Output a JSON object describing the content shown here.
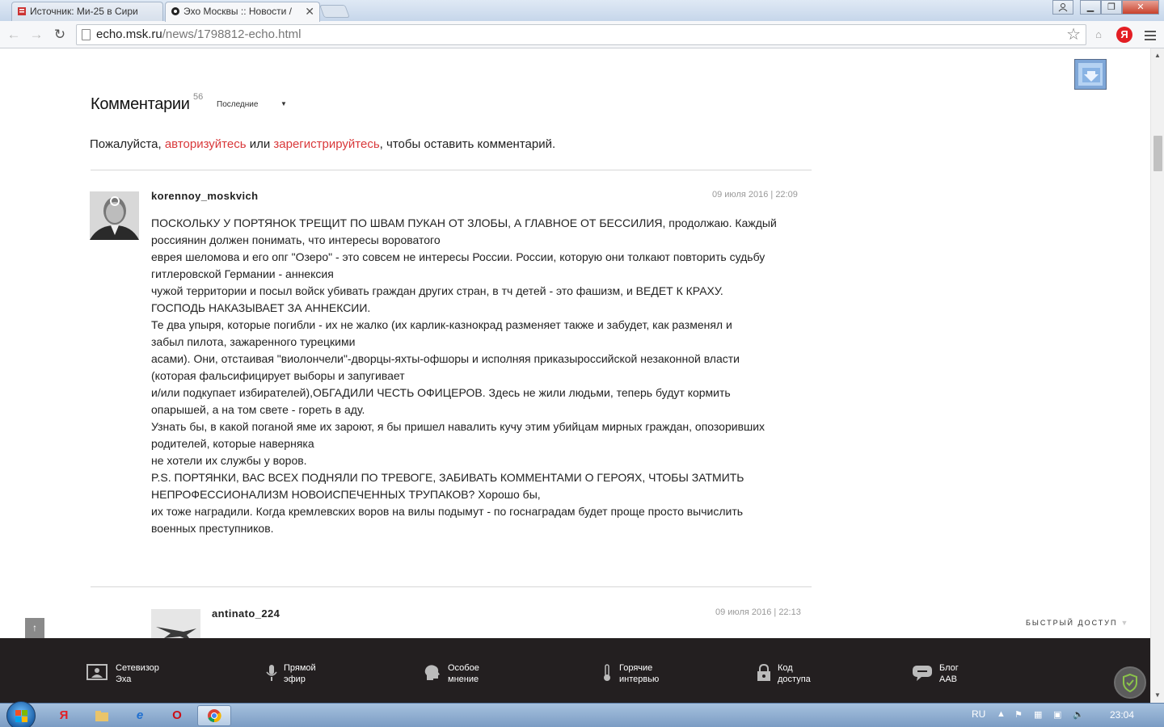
{
  "browser": {
    "tabs": [
      {
        "label": "Источник: Ми-25 в Сири",
        "active": false
      },
      {
        "label": "Эхо Москвы :: Новости /",
        "active": true
      }
    ],
    "url_domain": "echo.msk.ru",
    "url_path": "/news/1798812-echo.html",
    "yandex_ext_label": "Я"
  },
  "comments": {
    "title": "Комментарии",
    "count": "56",
    "sort_label": "Последние",
    "auth": {
      "prefix": "Пожалуйста, ",
      "login_link": "авторизуйтесь",
      "middle": " или ",
      "register_link": "зарегистрируйтесь",
      "suffix": ", чтобы оставить комментарий."
    },
    "items": [
      {
        "username": "korennoy_moskvich",
        "timestamp": "09 июля 2016 | 22:09",
        "lines": [
          "ПОСКОЛЬКУ У ПОРТЯНОК ТРЕЩИТ ПО ШВАМ ПУКАН ОТ ЗЛОБЫ, А ГЛАВНОЕ ОТ БЕССИЛИЯ, продолжаю. Каждый",
          "россиянин должен понимать, что интересы вороватого",
          "еврея шеломова и его опг \"Озеро\" - это совсем не интересы России. России, которую они толкают повторить судьбу",
          "гитлеровской Германии - аннексия",
          "чужой территории и посыл войск убивать граждан других стран, в тч детей - это фашизм, и ВЕДЕТ К КРАХУ.",
          "ГОСПОДЬ НАКАЗЫВАЕТ ЗА АННЕКСИИ.",
          "Те два упыря, которые погибли - их не жалко (их карлик-казнокрад разменяет также и забудет, как разменял и",
          "забыл пилота, зажаренного турецкими",
          "асами). Они, отстаивая \"виолончели\"-дворцы-яхты-офшоры и исполняя приказыроссийской незаконной власти",
          "(которая фальсифицирует выборы и запугивает",
          "и/или подкупает избирателей),ОБГАДИЛИ ЧЕСТЬ ОФИЦЕРОВ. Здесь не жили людьми, теперь будут кормить",
          "опарышей, а на том свете - гореть в аду.",
          "Узнать бы, в какой поганой яме их зароют, я бы пришел навалить кучу этим убийцам мирных граждан, опозоривших",
          "родителей, которые наверняка",
          "не хотели их службы у воров.",
          "P.S. ПОРТЯНКИ, ВАС ВСЕХ ПОДНЯЛИ ПО ТРЕВОГЕ, ЗАБИВАТЬ КОММЕНТАМИ О ГЕРОЯХ, ЧТОБЫ ЗАТМИТЬ",
          "НЕПРОФЕССИОНАЛИЗМ НОВОИСПЕЧЕННЫХ ТРУПАКОВ? Хорошо бы,",
          "их тоже наградили. Когда кремлевских воров на вилы подымут - по госнаградам будет проще просто вычислить",
          "военных преступников."
        ]
      },
      {
        "username": "antinato_224",
        "timestamp": "09 июля 2016 | 22:13"
      }
    ]
  },
  "quick_access": "БЫСТРЫЙ ДОСТУП",
  "bottom_nav": [
    {
      "line1": "Сетевизор",
      "line2": "Эха",
      "icon": "tv-icon"
    },
    {
      "line1": "Прямой",
      "line2": "эфир",
      "icon": "microphone-icon"
    },
    {
      "line1": "Особое",
      "line2": "мнение",
      "icon": "head-icon"
    },
    {
      "line1": "Горячие",
      "line2": "интервью",
      "icon": "thermometer-icon"
    },
    {
      "line1": "Код",
      "line2": "доступа",
      "icon": "lock-icon"
    },
    {
      "line1": "Блог",
      "line2": "ААВ",
      "icon": "speech-bubble-icon"
    }
  ],
  "taskbar": {
    "language": "RU",
    "clock": "23:04"
  }
}
